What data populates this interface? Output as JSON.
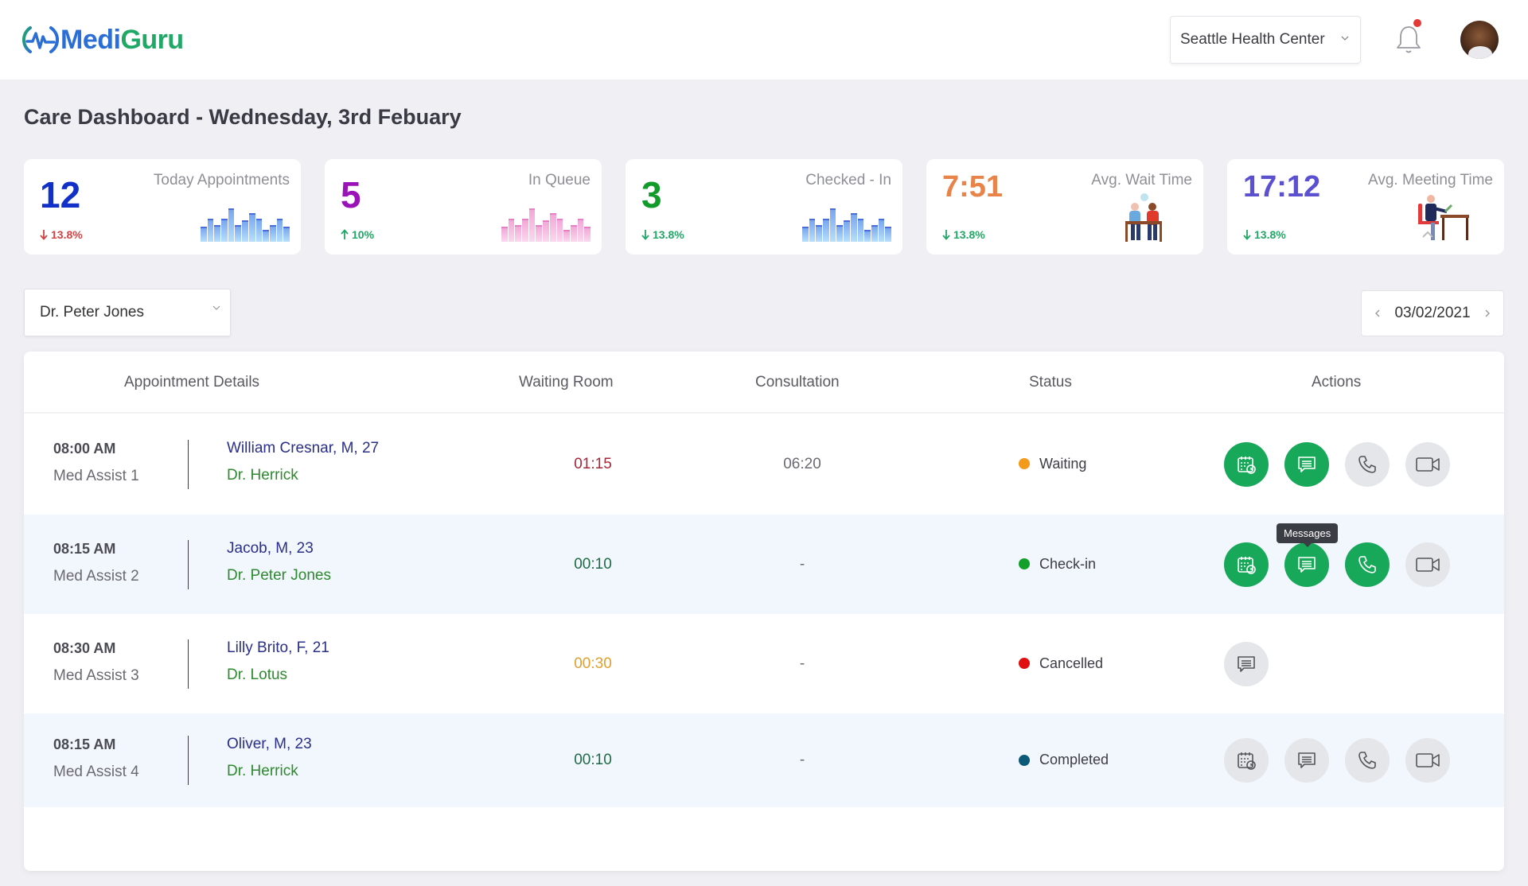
{
  "brand": {
    "name_part1": "Medi",
    "name_part2": "Guru"
  },
  "header": {
    "location_select": "Seattle Health Center",
    "notifications_has_unread": true
  },
  "page_title": "Care Dashboard - Wednesday, 3rd Febuary",
  "stats": [
    {
      "value": "12",
      "label": "Today Appointments",
      "trend": "13.8%",
      "trend_dir": "down",
      "value_color": "#1030c8",
      "trend_color": "#d64040",
      "visual": "bar-chart",
      "bar_color": "#7aa6f0",
      "bars": [
        0.45,
        0.7,
        0.5,
        0.7,
        1.0,
        0.5,
        0.65,
        0.85,
        0.7,
        0.35,
        0.5,
        0.7,
        0.45
      ]
    },
    {
      "value": "5",
      "label": "In Queue",
      "trend": "10%",
      "trend_dir": "up",
      "value_color": "#9a12b8",
      "trend_color": "#1fa866",
      "visual": "bar-chart",
      "bar_color": "#f2a8d8",
      "bars": [
        0.45,
        0.7,
        0.5,
        0.7,
        1.0,
        0.5,
        0.65,
        0.85,
        0.7,
        0.35,
        0.5,
        0.7,
        0.45
      ]
    },
    {
      "value": "3",
      "label": "Checked - In",
      "trend": "13.8%",
      "trend_dir": "down",
      "value_color": "#129a2a",
      "trend_color": "#1fa866",
      "visual": "bar-chart",
      "bar_color": "#7aa6f0",
      "bars": [
        0.45,
        0.7,
        0.5,
        0.7,
        1.0,
        0.5,
        0.65,
        0.85,
        0.7,
        0.35,
        0.5,
        0.7,
        0.45
      ]
    },
    {
      "value": "7:51",
      "label": "Avg. Wait Time",
      "trend": "13.8%",
      "trend_dir": "down",
      "value_color": "#e8844a",
      "trend_color": "#1fa866",
      "visual": "waiting-people-illustration"
    },
    {
      "value": "17:12",
      "label": "Avg. Meeting Time",
      "trend": "13.8%",
      "trend_dir": "down",
      "value_color": "#5a50d0",
      "trend_color": "#1fa866",
      "visual": "person-at-desk-illustration"
    }
  ],
  "doctor_select": "Dr. Peter Jones",
  "date_picker": {
    "value": "03/02/2021"
  },
  "table": {
    "columns": [
      "Appointment Details",
      "Waiting Room",
      "Consultation",
      "Status",
      "Actions"
    ],
    "rows": [
      {
        "time": "08:00 AM",
        "assistant": "Med Assist 1",
        "patient": "William Cresnar, M, 27",
        "doctor": "Dr. Herrick",
        "waiting": "01:15",
        "waiting_color": "#a8283a",
        "consultation": "06:20",
        "status": "Waiting",
        "status_color": "#f39a1a",
        "actions": [
          {
            "type": "schedule",
            "active": true
          },
          {
            "type": "message",
            "active": true
          },
          {
            "type": "call",
            "active": false
          },
          {
            "type": "video",
            "active": false
          }
        ]
      },
      {
        "time": "08:15 AM",
        "assistant": "Med Assist 2",
        "patient": "Jacob, M, 23",
        "doctor": "Dr. Peter Jones",
        "waiting": "00:10",
        "waiting_color": "#1f6b44",
        "consultation": "-",
        "status": "Check-in",
        "status_color": "#12a02a",
        "actions": [
          {
            "type": "schedule",
            "active": true
          },
          {
            "type": "message",
            "active": true
          },
          {
            "type": "call",
            "active": true
          },
          {
            "type": "video",
            "active": false
          }
        ]
      },
      {
        "time": "08:30 AM",
        "assistant": "Med Assist 3",
        "patient": "Lilly Brito, F, 21",
        "doctor": "Dr. Lotus",
        "waiting": "00:30",
        "waiting_color": "#e0a030",
        "consultation": "-",
        "status": "Cancelled",
        "status_color": "#e01010",
        "actions": [
          {
            "type": "message",
            "active": false
          }
        ]
      },
      {
        "time": "08:15 AM",
        "assistant": "Med Assist 4",
        "patient": "Oliver, M, 23",
        "doctor": "Dr. Herrick",
        "waiting": "00:10",
        "waiting_color": "#1f6b44",
        "consultation": "-",
        "status": "Completed",
        "status_color": "#0d5a78",
        "actions": [
          {
            "type": "schedule",
            "active": false
          },
          {
            "type": "message",
            "active": false
          },
          {
            "type": "call",
            "active": false
          },
          {
            "type": "video",
            "active": false
          }
        ]
      }
    ]
  },
  "tooltip": {
    "text": "Messages"
  }
}
